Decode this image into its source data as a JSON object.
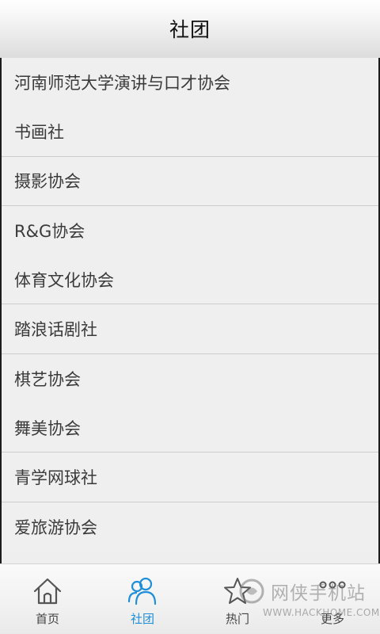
{
  "header": {
    "title": "社团"
  },
  "clubs": [
    {
      "name": "河南师范大学演讲与口才协会"
    },
    {
      "name": "书画社"
    },
    {
      "name": "摄影协会"
    },
    {
      "name": "R&G协会"
    },
    {
      "name": "体育文化协会"
    },
    {
      "name": "踏浪话剧社"
    },
    {
      "name": "棋艺协会"
    },
    {
      "name": "舞美协会"
    },
    {
      "name": "青学网球社"
    },
    {
      "name": "爱旅游协会"
    }
  ],
  "tabs": [
    {
      "label": "首页",
      "icon": "home-icon",
      "active": false
    },
    {
      "label": "社团",
      "icon": "users-icon",
      "active": true
    },
    {
      "label": "热门",
      "icon": "star-icon",
      "active": false
    },
    {
      "label": "更多",
      "icon": "more-icon",
      "active": false
    }
  ],
  "watermark": {
    "text": "网侠手机站",
    "url": "WWW.HACKHOME.COM"
  },
  "colors": {
    "active_tab": "#1f8fd8",
    "inactive_tab": "#444444"
  }
}
